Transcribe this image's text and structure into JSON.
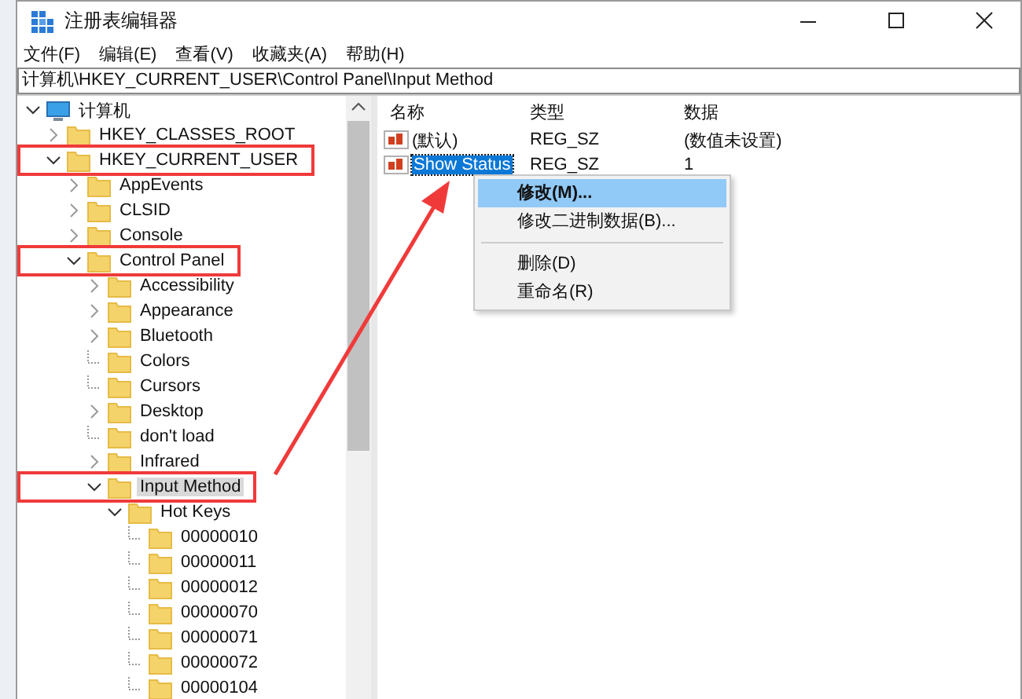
{
  "window": {
    "title": "注册表编辑器"
  },
  "menu": [
    "文件(F)",
    "编辑(E)",
    "查看(V)",
    "收藏夹(A)",
    "帮助(H)"
  ],
  "address": "计算机\\HKEY_CURRENT_USER\\Control Panel\\Input Method",
  "tree": [
    {
      "label": "计算机",
      "kind": "computer",
      "expanded": true,
      "selected": false,
      "highlighted": false,
      "children": [
        {
          "label": "HKEY_CLASSES_ROOT",
          "kind": "folder",
          "expanded": false,
          "selected": false,
          "highlighted": false
        },
        {
          "label": "HKEY_CURRENT_USER",
          "kind": "folder",
          "expanded": true,
          "selected": false,
          "highlighted": true,
          "children": [
            {
              "label": "AppEvents",
              "kind": "folder",
              "expanded": false,
              "selected": false,
              "highlighted": false
            },
            {
              "label": "CLSID",
              "kind": "folder",
              "expanded": false,
              "selected": false,
              "highlighted": false
            },
            {
              "label": "Console",
              "kind": "folder",
              "expanded": false,
              "selected": false,
              "highlighted": false
            },
            {
              "label": "Control Panel",
              "kind": "folder",
              "expanded": true,
              "selected": false,
              "highlighted": true,
              "children": [
                {
                  "label": "Accessibility",
                  "kind": "folder",
                  "expanded": false,
                  "selected": false,
                  "highlighted": false
                },
                {
                  "label": "Appearance",
                  "kind": "folder",
                  "expanded": false,
                  "selected": false,
                  "highlighted": false
                },
                {
                  "label": "Bluetooth",
                  "kind": "folder",
                  "expanded": false,
                  "selected": false,
                  "highlighted": false
                },
                {
                  "label": "Colors",
                  "kind": "leaf",
                  "selected": false,
                  "highlighted": false
                },
                {
                  "label": "Cursors",
                  "kind": "leaf",
                  "selected": false,
                  "highlighted": false
                },
                {
                  "label": "Desktop",
                  "kind": "folder",
                  "expanded": false,
                  "selected": false,
                  "highlighted": false
                },
                {
                  "label": "don't load",
                  "kind": "leaf",
                  "selected": false,
                  "highlighted": false
                },
                {
                  "label": "Infrared",
                  "kind": "folder",
                  "expanded": false,
                  "selected": false,
                  "highlighted": false
                },
                {
                  "label": "Input Method",
                  "kind": "folder",
                  "expanded": true,
                  "selected": true,
                  "highlighted": true,
                  "children": [
                    {
                      "label": "Hot Keys",
                      "kind": "folder",
                      "expanded": true,
                      "selected": false,
                      "highlighted": false,
                      "children": [
                        {
                          "label": "00000010",
                          "kind": "leaf",
                          "selected": false,
                          "highlighted": false
                        },
                        {
                          "label": "00000011",
                          "kind": "leaf",
                          "selected": false,
                          "highlighted": false
                        },
                        {
                          "label": "00000012",
                          "kind": "leaf",
                          "selected": false,
                          "highlighted": false
                        },
                        {
                          "label": "00000070",
                          "kind": "leaf",
                          "selected": false,
                          "highlighted": false
                        },
                        {
                          "label": "00000071",
                          "kind": "leaf",
                          "selected": false,
                          "highlighted": false
                        },
                        {
                          "label": "00000072",
                          "kind": "leaf",
                          "selected": false,
                          "highlighted": false
                        },
                        {
                          "label": "00000104",
                          "kind": "leaf",
                          "selected": false,
                          "highlighted": false
                        }
                      ]
                    }
                  ]
                }
              ]
            }
          ]
        }
      ]
    }
  ],
  "values": {
    "columns": [
      "名称",
      "类型",
      "数据"
    ],
    "rows": [
      {
        "name": "(默认)",
        "type": "REG_SZ",
        "data": "(数值未设置)",
        "selected": false
      },
      {
        "name": "Show Status",
        "type": "REG_SZ",
        "data": "1",
        "selected": true
      }
    ]
  },
  "context_menu": [
    {
      "kind": "item",
      "label": "修改(M)...",
      "default": true,
      "selected": true
    },
    {
      "kind": "item",
      "label": "修改二进制数据(B)...",
      "default": false,
      "selected": false
    },
    {
      "kind": "separator"
    },
    {
      "kind": "item",
      "label": "删除(D)",
      "default": false,
      "selected": false
    },
    {
      "kind": "item",
      "label": "重命名(R)",
      "default": false,
      "selected": false
    }
  ]
}
